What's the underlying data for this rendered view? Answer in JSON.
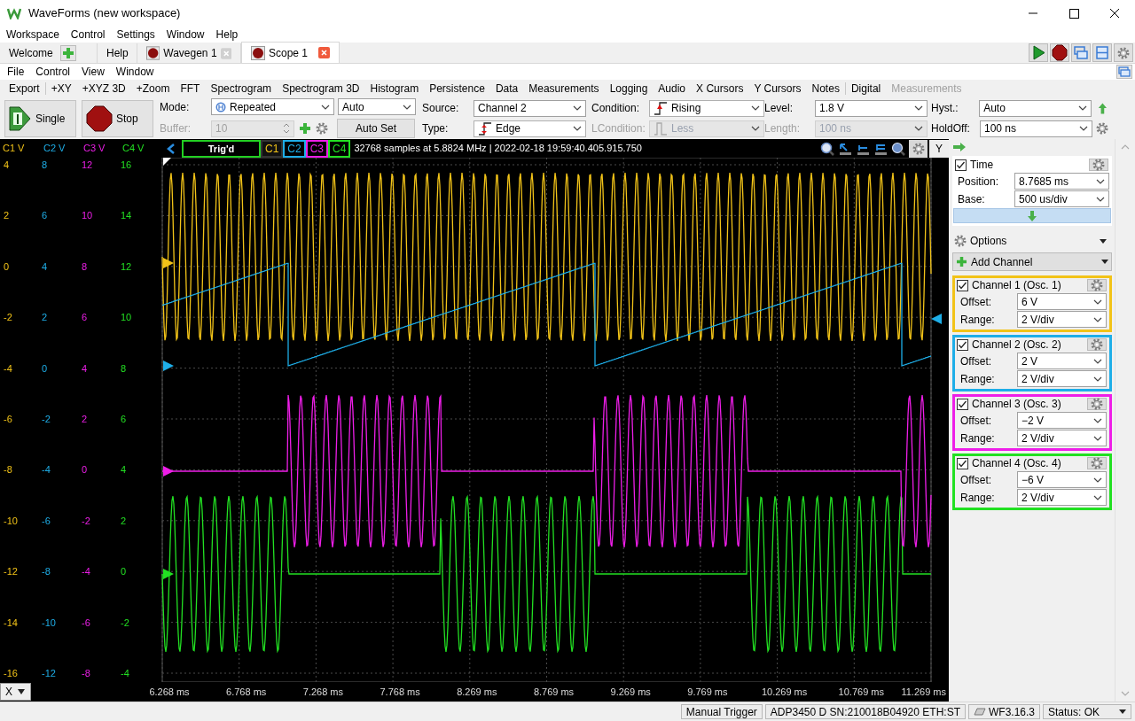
{
  "window": {
    "title": "WaveForms (new workspace)"
  },
  "menu": [
    "Workspace",
    "Control",
    "Settings",
    "Window",
    "Help"
  ],
  "tabs": [
    {
      "label": "Welcome",
      "selected": false,
      "kind": "add"
    },
    {
      "label": "Help",
      "selected": false,
      "kind": "plain"
    },
    {
      "label": "Wavegen 1",
      "selected": false,
      "kind": "instrument"
    },
    {
      "label": "Scope 1",
      "selected": true,
      "kind": "instrument"
    }
  ],
  "instrument_menu": [
    "File",
    "Control",
    "View",
    "Window"
  ],
  "toolbar": [
    [
      {
        "label": "Export",
        "disabled": false
      }
    ],
    [
      {
        "label": "+XY",
        "disabled": false
      },
      {
        "label": "+XYZ 3D",
        "disabled": false
      },
      {
        "label": "+Zoom",
        "disabled": false
      },
      {
        "label": "FFT",
        "disabled": false
      },
      {
        "label": "Spectrogram",
        "disabled": false
      },
      {
        "label": "Spectrogram 3D",
        "disabled": false
      },
      {
        "label": "Histogram",
        "disabled": false
      },
      {
        "label": "Persistence",
        "disabled": false
      },
      {
        "label": "Data",
        "disabled": false
      },
      {
        "label": "Measurements",
        "disabled": false
      },
      {
        "label": "Logging",
        "disabled": false
      },
      {
        "label": "Audio",
        "disabled": false
      },
      {
        "label": "X Cursors",
        "disabled": false
      },
      {
        "label": "Y Cursors",
        "disabled": false
      },
      {
        "label": "Notes",
        "disabled": false
      }
    ],
    [
      {
        "label": "Digital",
        "disabled": false
      },
      {
        "label": "Measurements",
        "disabled": true
      }
    ]
  ],
  "acquisition": {
    "single_button": "Single",
    "stop_button": "Stop",
    "mode": {
      "label": "Mode:",
      "value": "Repeated"
    },
    "auto_mode": "Auto",
    "buffer": {
      "label": "Buffer:",
      "value": "10",
      "disabled": true
    },
    "auto_set_button": "Auto Set"
  },
  "trigger_fields": [
    {
      "label": "Source:",
      "value": "Channel 2",
      "kind": "plain",
      "disabled": false
    },
    {
      "label": "Condition:",
      "value": "Rising",
      "kind": "rising",
      "disabled": false
    },
    {
      "label": "Level:",
      "value": "1.8 V",
      "kind": "plain",
      "disabled": false
    },
    {
      "label": "Hyst.:",
      "value": "Auto",
      "kind": "plain",
      "disabled": false
    },
    {
      "label": "Type:",
      "value": "Edge",
      "kind": "edge",
      "disabled": false
    },
    {
      "label": "LCondition:",
      "value": "Less",
      "kind": "pulse",
      "disabled": true
    },
    {
      "label": "Length:",
      "value": "100 ns",
      "kind": "plain",
      "disabled": true
    },
    {
      "label": "HoldOff:",
      "value": "100 ns",
      "kind": "plain",
      "disabled": false
    }
  ],
  "scope": {
    "trigger_status": "Trig'd",
    "info": "32768 samples at 5.8824 MHz | 2022-02-18 19:59:40.405.915.750",
    "y_button": "Y",
    "x_button": "X",
    "x_ticks": [
      "6.268 ms",
      "6.768 ms",
      "7.268 ms",
      "7.768 ms",
      "8.269 ms",
      "8.769 ms",
      "9.269 ms",
      "9.769 ms",
      "10.269 ms",
      "10.769 ms",
      "11.269 ms"
    ]
  },
  "channels": [
    {
      "chip": "C1",
      "axis_unit": "C1 V",
      "color": "#f2c318",
      "y_ticks": [
        "4",
        "2",
        "0",
        "-2",
        "-4",
        "-6",
        "-8",
        "-10",
        "-12",
        "-14",
        "-16"
      ],
      "title": "Channel 1 (Osc. 1)",
      "checked": true,
      "fields": [
        {
          "label": "Offset:",
          "value": "6 V"
        },
        {
          "label": "Range:",
          "value": "2 V/div"
        }
      ]
    },
    {
      "chip": "C2",
      "axis_unit": "C2 V",
      "color": "#1eaee8",
      "y_ticks": [
        "8",
        "6",
        "4",
        "2",
        "0",
        "-2",
        "-4",
        "-6",
        "-8",
        "-10",
        "-12"
      ],
      "title": "Channel 2 (Osc. 2)",
      "checked": true,
      "fields": [
        {
          "label": "Offset:",
          "value": "2 V"
        },
        {
          "label": "Range:",
          "value": "2 V/div"
        }
      ]
    },
    {
      "chip": "C3",
      "axis_unit": "C3 V",
      "color": "#ee1ee8",
      "y_ticks": [
        "12",
        "10",
        "8",
        "6",
        "4",
        "2",
        "0",
        "-2",
        "-4",
        "-6",
        "-8"
      ],
      "title": "Channel 3 (Osc. 3)",
      "checked": true,
      "fields": [
        {
          "label": "Offset:",
          "value": "−2 V"
        },
        {
          "label": "Range:",
          "value": "2 V/div"
        }
      ]
    },
    {
      "chip": "C4",
      "axis_unit": "C4 V",
      "color": "#22e022",
      "y_ticks": [
        "16",
        "14",
        "12",
        "10",
        "8",
        "6",
        "4",
        "2",
        "0",
        "-2",
        "-4"
      ],
      "title": "Channel 4 (Osc. 4)",
      "checked": true,
      "fields": [
        {
          "label": "Offset:",
          "value": "−6 V"
        },
        {
          "label": "Range:",
          "value": "2 V/div"
        }
      ]
    }
  ],
  "time": {
    "title": "Time",
    "checked": true,
    "fields": [
      {
        "label": "Position:",
        "value": "8.7685 ms"
      },
      {
        "label": "Base:",
        "value": "500 us/div"
      }
    ]
  },
  "options": "Options",
  "add_channel": "Add Channel",
  "status_bar": [
    {
      "text": "Manual Trigger",
      "kind": "plain"
    },
    {
      "text": "ADP3450 D SN:210018B04920 ETH:ST",
      "kind": "plain"
    },
    {
      "text": "WF3.16.3",
      "kind": "version"
    },
    {
      "text": "Status: OK",
      "kind": "status"
    }
  ]
}
